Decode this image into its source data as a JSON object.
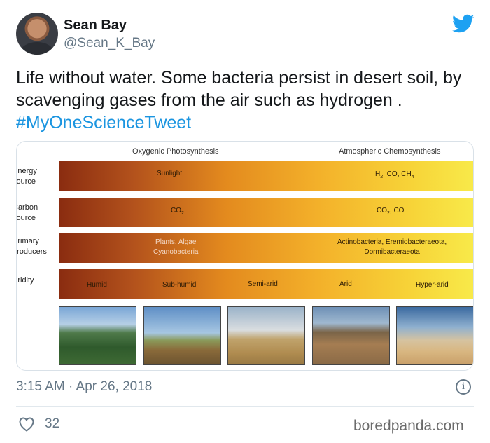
{
  "user": {
    "name": "Sean Bay",
    "handle": "@Sean_K_Bay"
  },
  "tweet": {
    "text": "Life without water. Some bacteria persist in desert soil, by scavenging gases from the air such as hydrogen . ",
    "hashtag": "#MyOneScienceTweet"
  },
  "figure": {
    "left_heading": "Oxygenic Photosynthesis",
    "right_heading": "Atmospheric Chemosynthesis",
    "rows": {
      "energy": {
        "label_1": "Energy",
        "label_2": "source",
        "left": "Sunlight",
        "right_main": "H",
        "right_sub": "2",
        "right_mid": ", CO, CH",
        "right_sub2": "4"
      },
      "carbon": {
        "label_1": "Carbon",
        "label_2": "source",
        "left_main": "CO",
        "left_sub": "2",
        "right_main": "CO",
        "right_sub": "2",
        "right_tail": ", CO"
      },
      "producers": {
        "label_1": "Primary",
        "label_2": "producers",
        "left_1": "Plants, Algae",
        "left_2": "Cyanobacteria",
        "right_1": "Actinobacteria, Eremiobacteraeota,",
        "right_2": "Dormibacteraeota"
      },
      "aridity": {
        "label": "Aridity",
        "stages": [
          "Humid",
          "Sub-humid",
          "Semi-arid",
          "Arid",
          "Hyper-arid"
        ]
      }
    }
  },
  "footer": {
    "timestamp": "3:15 AM · Apr 26, 2018",
    "info": "i",
    "likes": "32",
    "watermark": "boredpanda.com"
  },
  "colors": {
    "hashtag": "#1b95e0",
    "bird": "#1da1f2",
    "secondary_text": "#657786"
  },
  "icons": {
    "brand": "twitter-bird-icon",
    "info": "info-icon",
    "like": "heart-icon"
  }
}
